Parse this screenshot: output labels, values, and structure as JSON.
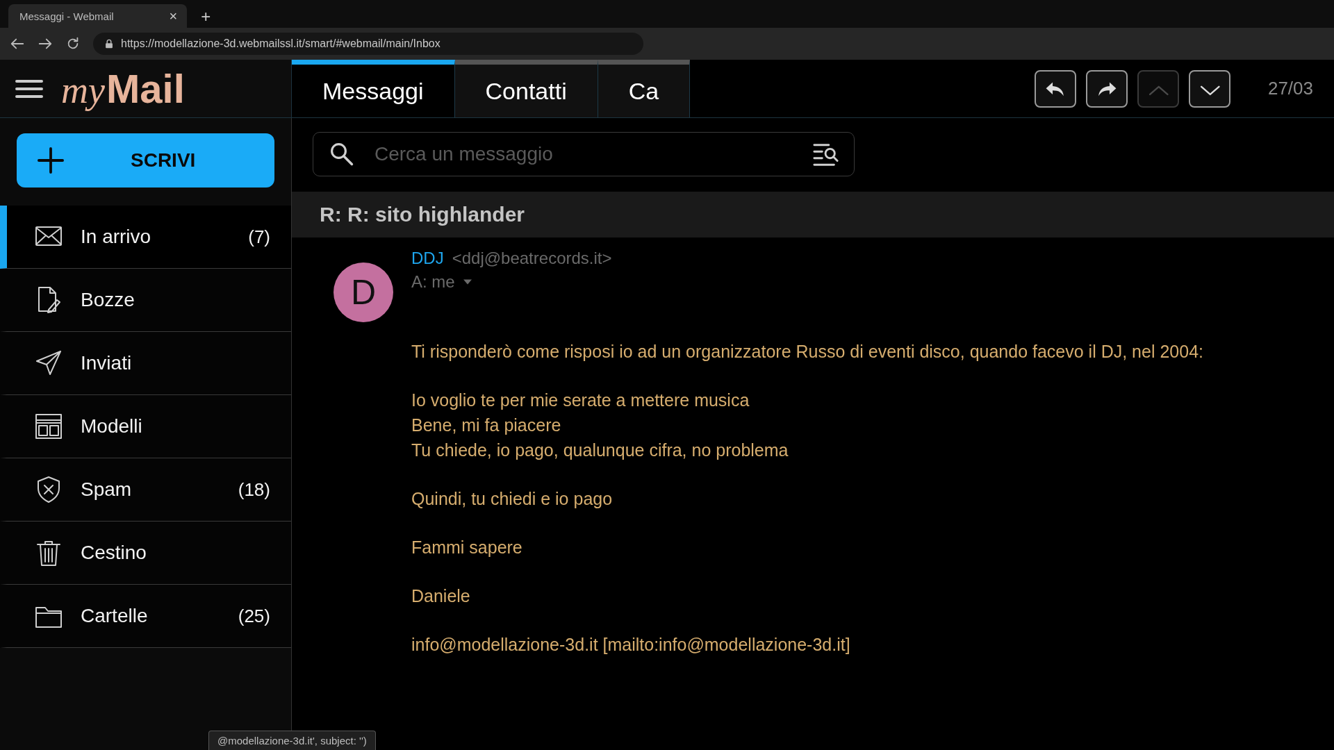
{
  "browser": {
    "tab_title": "Messaggi - Webmail",
    "tab_close": "×",
    "new_tab": "+",
    "url": "https://modellazione-3d.webmailssl.it/smart/#webmail/main/Inbox"
  },
  "app": {
    "logo": "my**Mail**",
    "tabs": [
      {
        "label": "Messaggi",
        "selected": true
      },
      {
        "label": "Contatti",
        "selected": false
      },
      {
        "label": "Ca",
        "selected": false
      }
    ],
    "toolbar": {
      "buttons": [
        {
          "disabled": false
        },
        {
          "disabled": false
        },
        {
          "disabled": true
        },
        {
          "disabled": false
        }
      ],
      "date": "27/03"
    }
  },
  "sidebar": {
    "compose": "SCRIVI",
    "folders": [
      {
        "label": "In arrivo",
        "count": "(7)",
        "selected": true
      },
      {
        "label": "Bozze",
        "selected": false
      },
      {
        "label": "Inviati",
        "selected": false
      },
      {
        "label": "Modelli",
        "selected": false
      },
      {
        "label": "Spam",
        "count": "(18)",
        "selected": false
      },
      {
        "label": "Cestino",
        "selected": false
      },
      {
        "label": "Cartelle",
        "count": "(25)",
        "selected": false
      }
    ]
  },
  "search": {
    "placeholder": "Cerca un messaggio"
  },
  "message": {
    "subject": "R: R: sito highlander",
    "sender_name": "DDJ",
    "sender_email": "<ddj@beatrecords.it>",
    "recipient": "A: me",
    "avatar": "D",
    "body": [
      [
        "Ti risponderò come risposi io ad un organizzatore Russo di eventi disco, quando facevo il DJ, nel 2004:"
      ],
      [
        "Io voglio te per mie serate a mettere musica",
        "Bene, mi fa piacere",
        "Tu chiede, io pago, qualunque cifra, no problema"
      ],
      [
        "Quindi, tu chiedi e io pago"
      ],
      [
        "Fammi sapere"
      ],
      [
        "Daniele"
      ],
      [
        "info@modellazione-3d.it [mailto:info@modellazione-3d.it]"
      ]
    ]
  },
  "status_bar": {
    "text": "@modellazione-3d.it', subject: '')"
  }
}
